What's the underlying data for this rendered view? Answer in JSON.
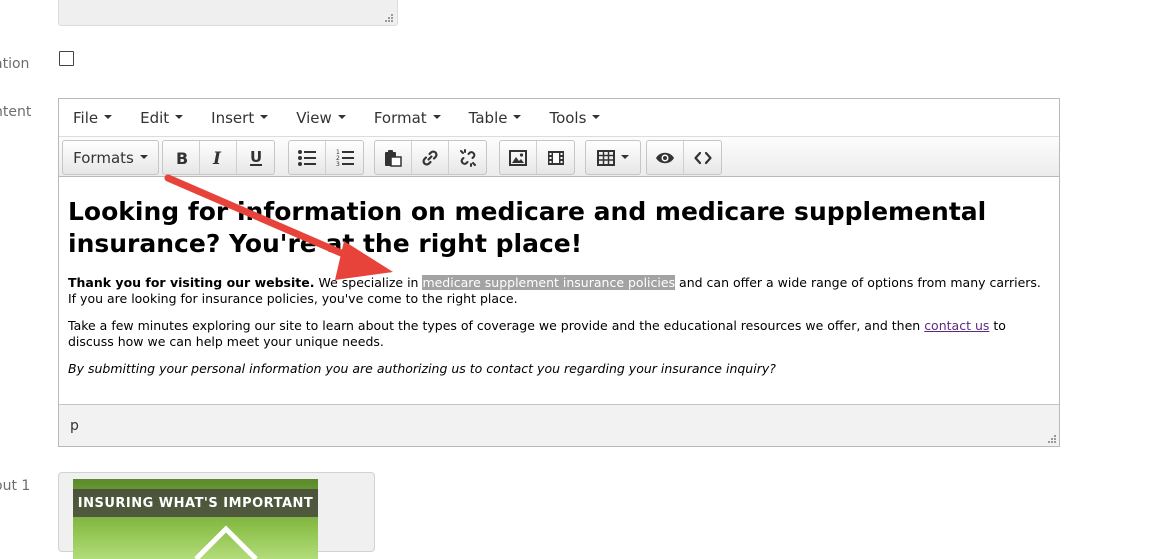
{
  "labels": {
    "partial_label_1": "ation",
    "partial_label_2": "ntent",
    "partial_label_3": "out 1"
  },
  "menubar": {
    "items": [
      "File",
      "Edit",
      "Insert",
      "View",
      "Format",
      "Table",
      "Tools"
    ]
  },
  "toolbar": {
    "formats_label": "Formats",
    "icons": [
      "bold-icon",
      "italic-icon",
      "underline-icon",
      "bullet-list-icon",
      "numbered-list-icon",
      "paste-icon",
      "link-icon",
      "unlink-icon",
      "image-icon",
      "media-icon",
      "table-icon",
      "preview-icon",
      "source-code-icon"
    ]
  },
  "content": {
    "heading": "Looking for information on medicare and medicare supplemental insurance? You're at the right place!",
    "p1_bold": "Thank you for visiting our website.",
    "p1_before": " We specialize in ",
    "p1_highlight": "medicare supplement insurance policies",
    "p1_after": " and can offer a wide range of options from many carriers. If you are looking for insurance policies, you've come to the right place.",
    "p2_before": "Take a few minutes exploring our site to learn about the types of coverage we provide and the educational resources we offer, and then ",
    "p2_link": "contact us",
    "p2_after": " to discuss how we can help meet your unique needs.",
    "p3_italic": "By submitting your personal information you are authorizing us to contact you regarding your insurance inquiry?"
  },
  "statusbar": {
    "path": "p"
  },
  "image_panel": {
    "banner_text": "INSURING WHAT'S IMPORTANT"
  },
  "colors": {
    "annotation_arrow": "#e8433a",
    "selection_highlight": "#a3a3a3",
    "link": "#5b2a86"
  }
}
